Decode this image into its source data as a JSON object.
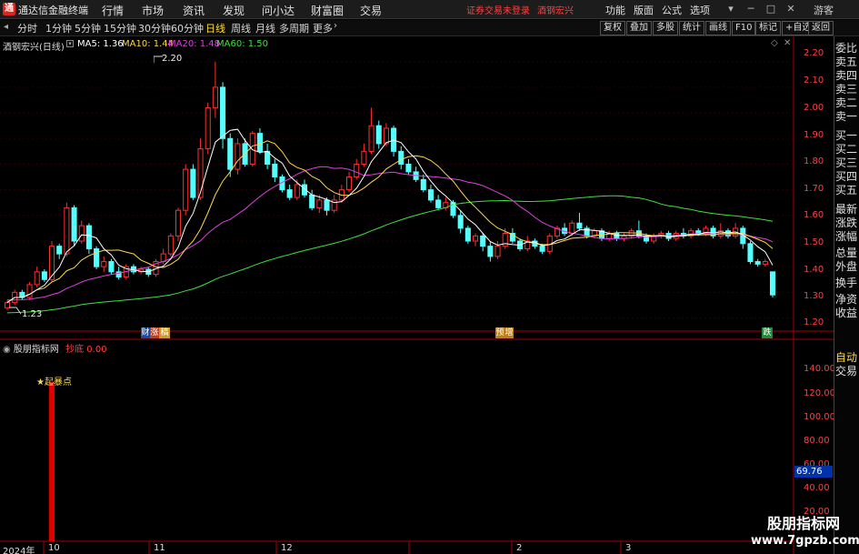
{
  "titlebar": {
    "logo": "通",
    "app_name": "通达信金融终端",
    "menus": [
      "行情",
      "市场",
      "资讯",
      "发现",
      "问小达",
      "财富圈",
      "交易"
    ],
    "alert": "证券交易未登录",
    "alert_stock": "酒钢宏兴",
    "right_menus": [
      "功能",
      "版面",
      "公式",
      "选项"
    ],
    "guest": "游客"
  },
  "toolbar": {
    "periods": [
      "分时",
      "1分钟",
      "5分钟",
      "15分钟",
      "30分钟",
      "60分钟",
      "日线",
      "周线",
      "月线",
      "多周期",
      "更多"
    ],
    "active_period": "日线",
    "right_tabs": [
      "复权",
      "叠加",
      "多股",
      "统计",
      "画线",
      "F10",
      "标记",
      "+自选",
      "返回"
    ]
  },
  "legend": {
    "stock": "酒钢宏兴(日线)",
    "ma5": "MA5: 1.36",
    "ma10": "MA10: 1.44",
    "ma20": "MA20: 1.48",
    "ma60": "MA60: 1.50",
    "colors": {
      "ma5": "#ffffff",
      "ma10": "#ffd84a",
      "ma20": "#e040e0",
      "ma60": "#40e040"
    }
  },
  "side_panel": [
    "委比",
    "卖五",
    "卖四",
    "卖三",
    "卖二",
    "卖一",
    "买一",
    "买二",
    "买三",
    "买四",
    "买五",
    "最新",
    "涨跌",
    "涨幅",
    "总量",
    "外盘",
    "换手",
    "净资",
    "收益"
  ],
  "side_panel_bottom": [
    "自动",
    "交易"
  ],
  "price_axis": [
    "2.20",
    "2.10",
    "2.00",
    "1.90",
    "1.80",
    "1.70",
    "1.60",
    "1.50",
    "1.40",
    "1.30",
    "1.20"
  ],
  "annotations": {
    "high": "2.20",
    "low": "1.23",
    "event_1": "财",
    "event_2": "涨",
    "event_3": "稿",
    "event_4": "预",
    "event_5": "增",
    "event_6": "跌"
  },
  "indicator": {
    "name": "股朋指标网",
    "line_name": "抄底",
    "line_value": "0.00",
    "axis": [
      "140.00",
      "120.00",
      "100.00",
      "80.00",
      "60.00",
      "40.00",
      "20.00"
    ],
    "current_value": "69.76",
    "marker_label": "起暴点"
  },
  "date_axis": {
    "labels": [
      "2024年",
      "10",
      "11",
      "12",
      "2",
      "3"
    ]
  },
  "watermark": {
    "line1": "股朋指标网",
    "line2": "www.7gpzb.com"
  },
  "chart_data": {
    "type": "candlestick",
    "ylim": [
      1.17,
      2.27
    ],
    "candles": [
      [
        1.24,
        1.26,
        1.23,
        1.27
      ],
      [
        1.26,
        1.3,
        1.25,
        1.31
      ],
      [
        1.3,
        1.28,
        1.27,
        1.31
      ],
      [
        1.28,
        1.33,
        1.27,
        1.34
      ],
      [
        1.33,
        1.38,
        1.32,
        1.4
      ],
      [
        1.38,
        1.35,
        1.34,
        1.39
      ],
      [
        1.35,
        1.48,
        1.34,
        1.5
      ],
      [
        1.48,
        1.45,
        1.43,
        1.49
      ],
      [
        1.45,
        1.63,
        1.44,
        1.65
      ],
      [
        1.63,
        1.5,
        1.48,
        1.64
      ],
      [
        1.5,
        1.56,
        1.49,
        1.58
      ],
      [
        1.56,
        1.47,
        1.45,
        1.57
      ],
      [
        1.47,
        1.4,
        1.39,
        1.48
      ],
      [
        1.4,
        1.42,
        1.38,
        1.44
      ],
      [
        1.42,
        1.38,
        1.37,
        1.43
      ],
      [
        1.38,
        1.36,
        1.35,
        1.4
      ],
      [
        1.36,
        1.4,
        1.35,
        1.41
      ],
      [
        1.4,
        1.38,
        1.37,
        1.41
      ],
      [
        1.38,
        1.39,
        1.37,
        1.4
      ],
      [
        1.39,
        1.37,
        1.36,
        1.4
      ],
      [
        1.37,
        1.42,
        1.36,
        1.43
      ],
      [
        1.42,
        1.45,
        1.41,
        1.47
      ],
      [
        1.45,
        1.52,
        1.44,
        1.53
      ],
      [
        1.52,
        1.62,
        1.5,
        1.63
      ],
      [
        1.62,
        1.78,
        1.6,
        1.8
      ],
      [
        1.78,
        1.67,
        1.66,
        1.8
      ],
      [
        1.67,
        1.86,
        1.66,
        1.9
      ],
      [
        1.86,
        2.02,
        1.84,
        2.04
      ],
      [
        2.02,
        2.1,
        1.98,
        2.2
      ],
      [
        2.1,
        1.9,
        1.86,
        2.12
      ],
      [
        1.9,
        1.78,
        1.75,
        1.92
      ],
      [
        1.78,
        1.88,
        1.76,
        1.9
      ],
      [
        1.88,
        1.8,
        1.79,
        1.9
      ],
      [
        1.8,
        1.92,
        1.79,
        1.93
      ],
      [
        1.92,
        1.85,
        1.84,
        1.94
      ],
      [
        1.85,
        1.8,
        1.78,
        1.88
      ],
      [
        1.8,
        1.75,
        1.73,
        1.82
      ],
      [
        1.75,
        1.7,
        1.69,
        1.76
      ],
      [
        1.7,
        1.67,
        1.66,
        1.72
      ],
      [
        1.67,
        1.72,
        1.66,
        1.74
      ],
      [
        1.72,
        1.68,
        1.67,
        1.74
      ],
      [
        1.68,
        1.63,
        1.62,
        1.7
      ],
      [
        1.63,
        1.66,
        1.61,
        1.68
      ],
      [
        1.66,
        1.62,
        1.6,
        1.67
      ],
      [
        1.62,
        1.66,
        1.61,
        1.68
      ],
      [
        1.66,
        1.7,
        1.65,
        1.72
      ],
      [
        1.7,
        1.75,
        1.69,
        1.77
      ],
      [
        1.75,
        1.8,
        1.74,
        1.82
      ],
      [
        1.8,
        1.85,
        1.79,
        1.88
      ],
      [
        1.85,
        1.95,
        1.84,
        2.02
      ],
      [
        1.95,
        1.88,
        1.86,
        1.97
      ],
      [
        1.88,
        1.94,
        1.87,
        1.96
      ],
      [
        1.94,
        1.85,
        1.83,
        1.95
      ],
      [
        1.85,
        1.8,
        1.78,
        1.87
      ],
      [
        1.8,
        1.77,
        1.76,
        1.82
      ],
      [
        1.77,
        1.74,
        1.73,
        1.79
      ],
      [
        1.74,
        1.7,
        1.69,
        1.76
      ],
      [
        1.7,
        1.66,
        1.65,
        1.72
      ],
      [
        1.66,
        1.63,
        1.62,
        1.68
      ],
      [
        1.63,
        1.65,
        1.62,
        1.67
      ],
      [
        1.65,
        1.6,
        1.59,
        1.66
      ],
      [
        1.6,
        1.55,
        1.53,
        1.62
      ],
      [
        1.55,
        1.5,
        1.49,
        1.56
      ],
      [
        1.5,
        1.52,
        1.48,
        1.53
      ],
      [
        1.52,
        1.48,
        1.46,
        1.53
      ],
      [
        1.48,
        1.44,
        1.42,
        1.5
      ],
      [
        1.44,
        1.48,
        1.43,
        1.5
      ],
      [
        1.48,
        1.53,
        1.47,
        1.55
      ],
      [
        1.53,
        1.5,
        1.49,
        1.55
      ],
      [
        1.5,
        1.47,
        1.46,
        1.51
      ],
      [
        1.47,
        1.5,
        1.46,
        1.52
      ],
      [
        1.5,
        1.48,
        1.47,
        1.51
      ],
      [
        1.48,
        1.46,
        1.45,
        1.49
      ],
      [
        1.46,
        1.52,
        1.45,
        1.53
      ],
      [
        1.52,
        1.55,
        1.51,
        1.56
      ],
      [
        1.55,
        1.53,
        1.52,
        1.57
      ],
      [
        1.53,
        1.57,
        1.52,
        1.58
      ],
      [
        1.57,
        1.55,
        1.54,
        1.61
      ],
      [
        1.55,
        1.52,
        1.51,
        1.56
      ],
      [
        1.52,
        1.54,
        1.51,
        1.55
      ],
      [
        1.54,
        1.51,
        1.5,
        1.55
      ],
      [
        1.51,
        1.53,
        1.5,
        1.54
      ],
      [
        1.53,
        1.51,
        1.5,
        1.54
      ],
      [
        1.51,
        1.52,
        1.5,
        1.53
      ],
      [
        1.52,
        1.54,
        1.51,
        1.55
      ],
      [
        1.54,
        1.52,
        1.51,
        1.58
      ],
      [
        1.52,
        1.5,
        1.49,
        1.53
      ],
      [
        1.5,
        1.52,
        1.49,
        1.53
      ],
      [
        1.52,
        1.53,
        1.51,
        1.54
      ],
      [
        1.53,
        1.51,
        1.5,
        1.54
      ],
      [
        1.51,
        1.53,
        1.5,
        1.54
      ],
      [
        1.53,
        1.52,
        1.51,
        1.55
      ],
      [
        1.52,
        1.54,
        1.51,
        1.55
      ],
      [
        1.54,
        1.53,
        1.52,
        1.55
      ],
      [
        1.53,
        1.55,
        1.52,
        1.56
      ],
      [
        1.55,
        1.52,
        1.51,
        1.56
      ],
      [
        1.52,
        1.54,
        1.51,
        1.57
      ],
      [
        1.54,
        1.52,
        1.51,
        1.55
      ],
      [
        1.52,
        1.55,
        1.51,
        1.57
      ],
      [
        1.55,
        1.49,
        1.47,
        1.56
      ],
      [
        1.49,
        1.42,
        1.41,
        1.5
      ],
      [
        1.42,
        1.41,
        1.4,
        1.43
      ],
      [
        1.41,
        1.42,
        1.4,
        1.43
      ],
      [
        1.38,
        1.29,
        1.28,
        1.38
      ]
    ],
    "indicator_spike_index": 6,
    "indicator_spike_value": 135,
    "indicator_ylim": [
      0,
      150
    ]
  }
}
